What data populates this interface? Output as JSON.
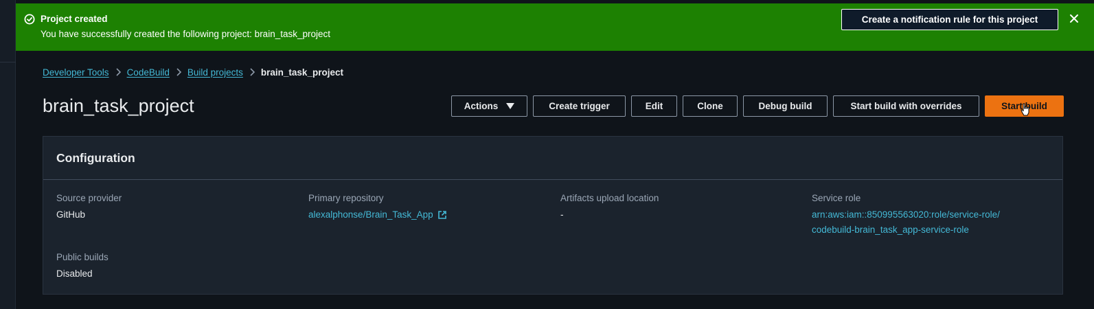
{
  "flash": {
    "title": "Project created",
    "message": "You have successfully created the following project: brain_task_project",
    "notification_button": "Create a notification rule for this project"
  },
  "breadcrumb": {
    "items": [
      "Developer Tools",
      "CodeBuild",
      "Build projects"
    ],
    "current": "brain_task_project"
  },
  "header": {
    "title": "brain_task_project",
    "buttons": {
      "actions": "Actions",
      "create_trigger": "Create trigger",
      "edit": "Edit",
      "clone": "Clone",
      "debug_build": "Debug build",
      "start_with_overrides": "Start build with overrides",
      "start_build": "Start build"
    }
  },
  "configuration": {
    "title": "Configuration",
    "source_provider": {
      "label": "Source provider",
      "value": "GitHub"
    },
    "primary_repository": {
      "label": "Primary repository",
      "value": "alexalphonse/Brain_Task_App"
    },
    "artifacts_location": {
      "label": "Artifacts upload location",
      "value": "-"
    },
    "service_role": {
      "label": "Service role",
      "value_line1": "arn:aws:iam::850995563020:role/service-role/",
      "value_line2": "codebuild-brain_task_app-service-role"
    },
    "public_builds": {
      "label": "Public builds",
      "value": "Disabled"
    }
  },
  "colors": {
    "success": "#1d8102",
    "primary": "#ec7211",
    "link": "#44b9d6",
    "background": "#0f141a",
    "card": "#1b232d"
  },
  "icons": [
    "success-check-icon",
    "close-icon",
    "chevron-right-icon",
    "caret-down-icon",
    "external-link-icon",
    "hand-cursor-icon"
  ]
}
